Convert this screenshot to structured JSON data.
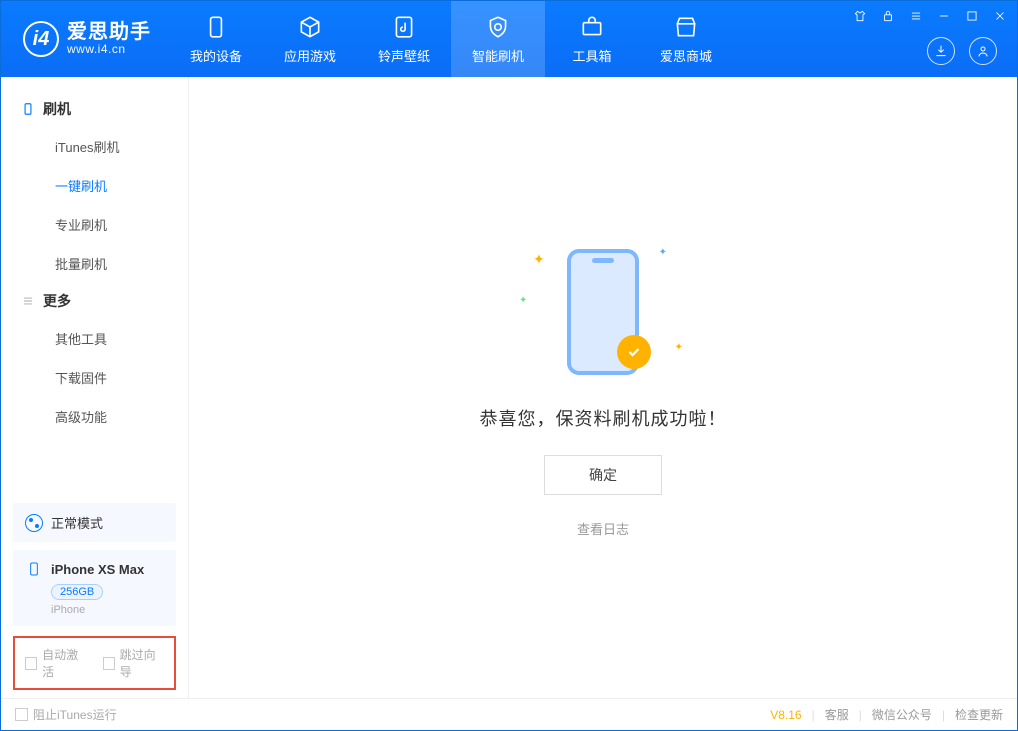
{
  "app": {
    "name": "爱思助手",
    "domain": "www.i4.cn"
  },
  "tabs": [
    {
      "id": "device",
      "label": "我的设备"
    },
    {
      "id": "apps",
      "label": "应用游戏"
    },
    {
      "id": "ring",
      "label": "铃声壁纸"
    },
    {
      "id": "flash",
      "label": "智能刷机",
      "active": true
    },
    {
      "id": "tools",
      "label": "工具箱"
    },
    {
      "id": "store",
      "label": "爱思商城"
    }
  ],
  "sidebar": {
    "group1": {
      "title": "刷机",
      "items": [
        "iTunes刷机",
        "一键刷机",
        "专业刷机",
        "批量刷机"
      ],
      "activeIndex": 1
    },
    "group2": {
      "title": "更多",
      "items": [
        "其他工具",
        "下载固件",
        "高级功能"
      ]
    }
  },
  "mode": {
    "label": "正常模式"
  },
  "device": {
    "name": "iPhone XS Max",
    "capacity": "256GB",
    "type": "iPhone"
  },
  "options": {
    "autoActivate": "自动激活",
    "skipGuide": "跳过向导"
  },
  "main": {
    "message": "恭喜您，保资料刷机成功啦！",
    "okButton": "确定",
    "logLink": "查看日志"
  },
  "footer": {
    "blockItunes": "阻止iTunes运行",
    "version": "V8.16",
    "links": [
      "客服",
      "微信公众号",
      "检查更新"
    ]
  }
}
